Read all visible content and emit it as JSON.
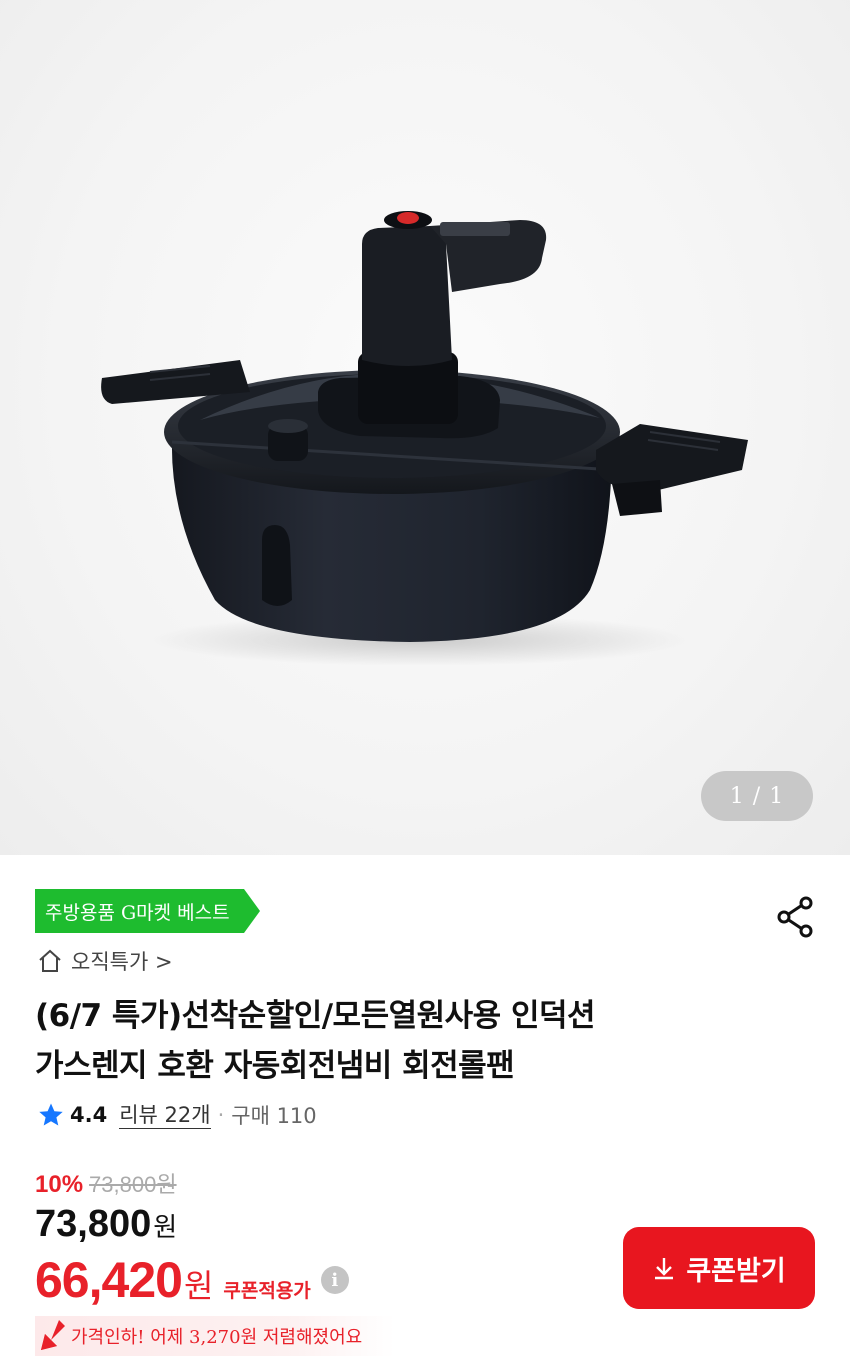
{
  "gallery": {
    "counter": "1 / 1",
    "image_alt": "자동회전냄비 회전롤팬"
  },
  "badge": {
    "label": "주방용품 G마켓 베스트"
  },
  "shop": {
    "label": "오직특가 >"
  },
  "product": {
    "title_line1": "(6/7 특가)선착순할인/모든열원사용 인덕션",
    "title_line2": "가스렌지 호환 자동회전냄비 회전롤팬"
  },
  "rating": {
    "score": "4.4",
    "review_label": "리뷰 22개",
    "separator": "·",
    "purchase_label": "구매 110"
  },
  "price": {
    "discount_rate": "10%",
    "original": "73,800원",
    "sale_number": "73,800",
    "sale_unit": "원",
    "coupon_number": "66,420",
    "coupon_unit": "원",
    "coupon_label": "쿠폰적용가",
    "info_symbol": "i"
  },
  "coupon_button": {
    "label": "쿠폰받기"
  },
  "price_drop": {
    "text": "가격인하! 어제 3,270원 저렴해졌어요"
  },
  "colors": {
    "accent_red": "#e8212a",
    "badge_green": "#1ebc2f"
  },
  "icons": {
    "share": "share-icon",
    "home": "home-icon",
    "star": "star-icon",
    "download": "download-icon",
    "price_down": "down-arrow-icon"
  }
}
